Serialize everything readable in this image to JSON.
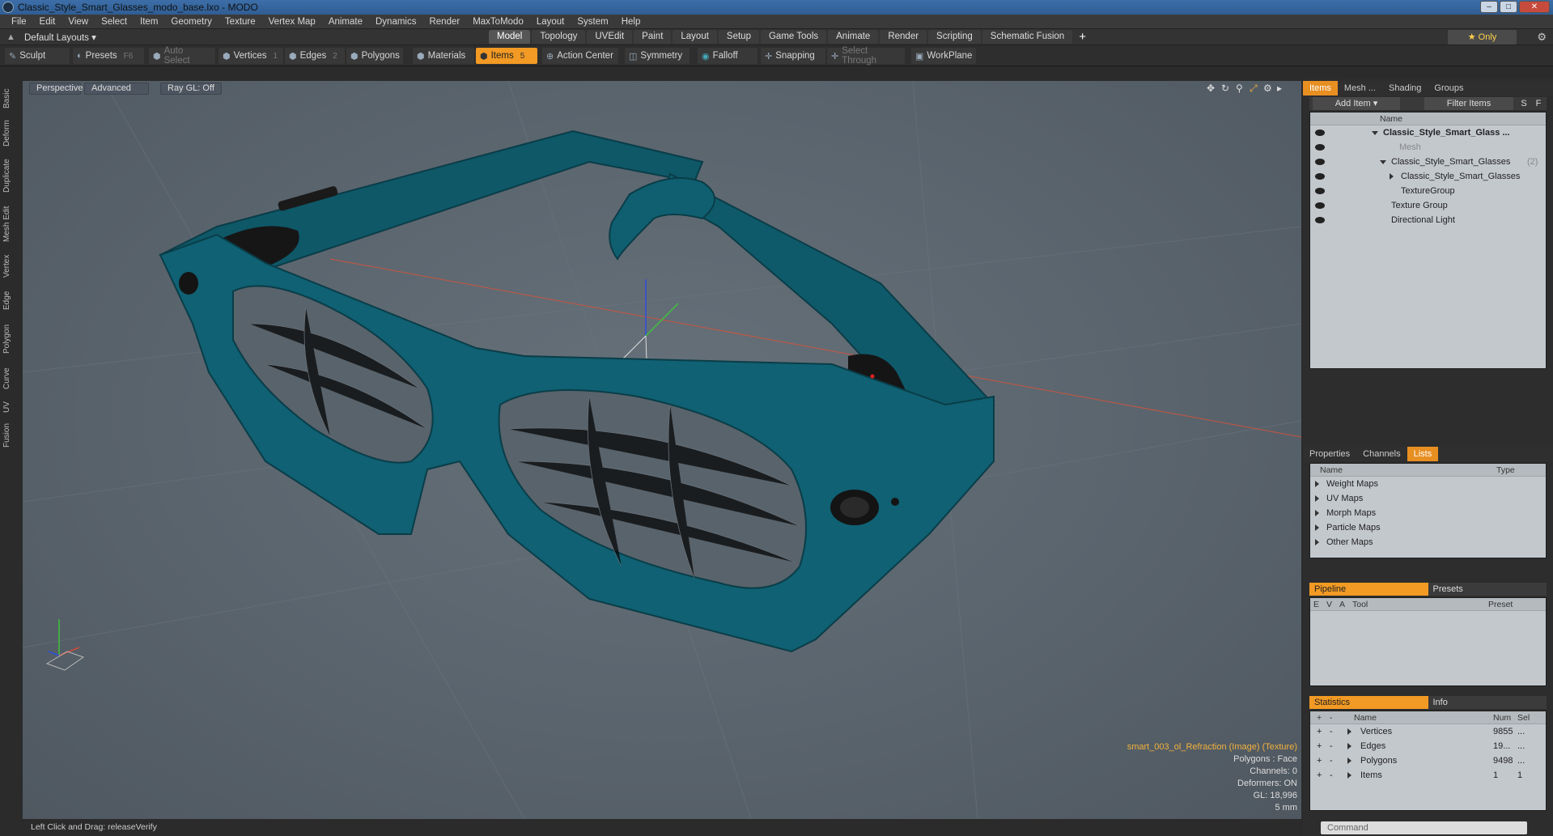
{
  "window": {
    "title": "Classic_Style_Smart_Glasses_modo_base.lxo - MODO"
  },
  "menu": [
    "File",
    "Edit",
    "View",
    "Select",
    "Item",
    "Geometry",
    "Texture",
    "Vertex Map",
    "Animate",
    "Dynamics",
    "Render",
    "MaxToModo",
    "Layout",
    "System",
    "Help"
  ],
  "layoutbar": {
    "layout": "Default Layouts",
    "tabs": [
      "Model",
      "Topology",
      "UVEdit",
      "Paint",
      "Layout",
      "Setup",
      "Game Tools",
      "Animate",
      "Render",
      "Scripting",
      "Schematic Fusion"
    ],
    "active_tab": "Model",
    "only": "Only"
  },
  "toolbar": {
    "sculpt": "Sculpt",
    "presets": "Presets",
    "presets_key": "F6",
    "auto_select": "Auto Select",
    "vertices": "Vertices",
    "vertices_key": "1",
    "edges": "Edges",
    "edges_key": "2",
    "polygons": "Polygons",
    "materials": "Materials",
    "items": "Items",
    "items_key": "5",
    "action_center": "Action Center",
    "symmetry": "Symmetry",
    "falloff": "Falloff",
    "snapping": "Snapping",
    "select_through": "Select Through",
    "workplane": "WorkPlane"
  },
  "left_tabs": [
    "Basic",
    "Deform",
    "Duplicate",
    "Mesh Edit",
    "Vertex",
    "Edge",
    "Polygon",
    "Curve",
    "UV",
    "Fusion"
  ],
  "viewport": {
    "view": "Perspective",
    "shading": "Advanced",
    "raygl": "Ray GL: Off",
    "info": {
      "texture": "smart_003_ol_Refraction (Image) (Texture)",
      "polygons": "Polygons : Face",
      "channels": "Channels: 0",
      "deformers": "Deformers: ON",
      "gl": "GL: 18,996",
      "scale": "5 mm"
    },
    "model_color": "#0f5c6b"
  },
  "status": {
    "text": "Left Click and Drag:   releaseVerify"
  },
  "items_panel": {
    "tabs": [
      "Items",
      "Mesh ...",
      "Shading",
      "Groups"
    ],
    "add_item": "Add Item",
    "filter_items": "Filter Items",
    "s_btn": "S",
    "f_btn": "F",
    "col_name": "Name",
    "rows": [
      {
        "label": "Classic_Style_Smart_Glass ...",
        "indent": 0,
        "bold": true
      },
      {
        "label": "Mesh",
        "indent": 1,
        "dim": true
      },
      {
        "label": "Classic_Style_Smart_Glasses",
        "suffix": "(2)",
        "indent": 1
      },
      {
        "label": "Classic_Style_Smart_Glasses",
        "indent": 2
      },
      {
        "label": "TextureGroup",
        "indent": 2
      },
      {
        "label": "Texture Group",
        "indent": 1
      },
      {
        "label": "Directional Light",
        "indent": 1
      }
    ]
  },
  "lists_panel": {
    "tabs": [
      "Properties",
      "Channels",
      "Lists"
    ],
    "col_name": "Name",
    "col_type": "Type",
    "rows": [
      "Weight Maps",
      "UV Maps",
      "Morph Maps",
      "Particle Maps",
      "Other Maps"
    ]
  },
  "pipeline_panel": {
    "tabs": [
      "Pipeline",
      "Presets"
    ],
    "cols": [
      "E",
      "V",
      "A",
      "Tool",
      "Preset"
    ]
  },
  "stats_panel": {
    "tabs": [
      "Statistics",
      "Info"
    ],
    "cols": [
      "Name",
      "Num",
      "Sel"
    ],
    "rows": [
      {
        "name": "Vertices",
        "num": "9855",
        "sel": "..."
      },
      {
        "name": "Edges",
        "num": "19...",
        "sel": "..."
      },
      {
        "name": "Polygons",
        "num": "9498",
        "sel": "..."
      },
      {
        "name": "Items",
        "num": "1",
        "sel": "1"
      }
    ]
  },
  "command": {
    "placeholder": "Command"
  }
}
